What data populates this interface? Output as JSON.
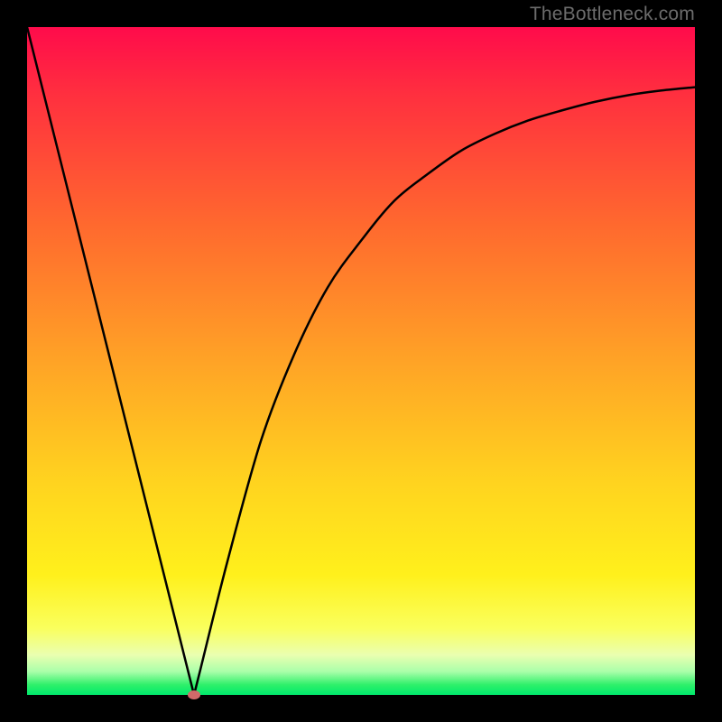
{
  "watermark": "TheBottleneck.com",
  "colors": {
    "frame": "#000000",
    "grad_top": "#ff0b4b",
    "grad_bottom": "#00e96c",
    "curve": "#000000",
    "marker": "#d16a6a"
  },
  "chart_data": {
    "type": "line",
    "title": "",
    "xlabel": "",
    "ylabel": "",
    "xlim": [
      0,
      100
    ],
    "ylim": [
      0,
      100
    ],
    "notch_x": 25,
    "marker": {
      "x": 25,
      "y": 0
    },
    "series": [
      {
        "name": "curve",
        "x": [
          0,
          5,
          10,
          15,
          20,
          24,
          25,
          26,
          30,
          35,
          40,
          45,
          50,
          55,
          60,
          65,
          70,
          75,
          80,
          85,
          90,
          95,
          100
        ],
        "y": [
          100,
          80,
          60,
          40,
          20,
          4,
          0,
          4,
          20,
          38,
          51,
          61,
          68,
          74,
          78,
          81.5,
          84,
          86,
          87.5,
          88.8,
          89.8,
          90.5,
          91
        ]
      }
    ],
    "gradient_stops": [
      {
        "pct": 0,
        "color": "#ff0b4b"
      },
      {
        "pct": 10,
        "color": "#ff2f3f"
      },
      {
        "pct": 30,
        "color": "#ff6a2e"
      },
      {
        "pct": 50,
        "color": "#ffa326"
      },
      {
        "pct": 68,
        "color": "#ffd31f"
      },
      {
        "pct": 82,
        "color": "#fff01c"
      },
      {
        "pct": 90,
        "color": "#faff5d"
      },
      {
        "pct": 94,
        "color": "#eaffb0"
      },
      {
        "pct": 96.5,
        "color": "#aaffaa"
      },
      {
        "pct": 98.5,
        "color": "#2ef06a"
      },
      {
        "pct": 100,
        "color": "#00e96c"
      }
    ]
  }
}
